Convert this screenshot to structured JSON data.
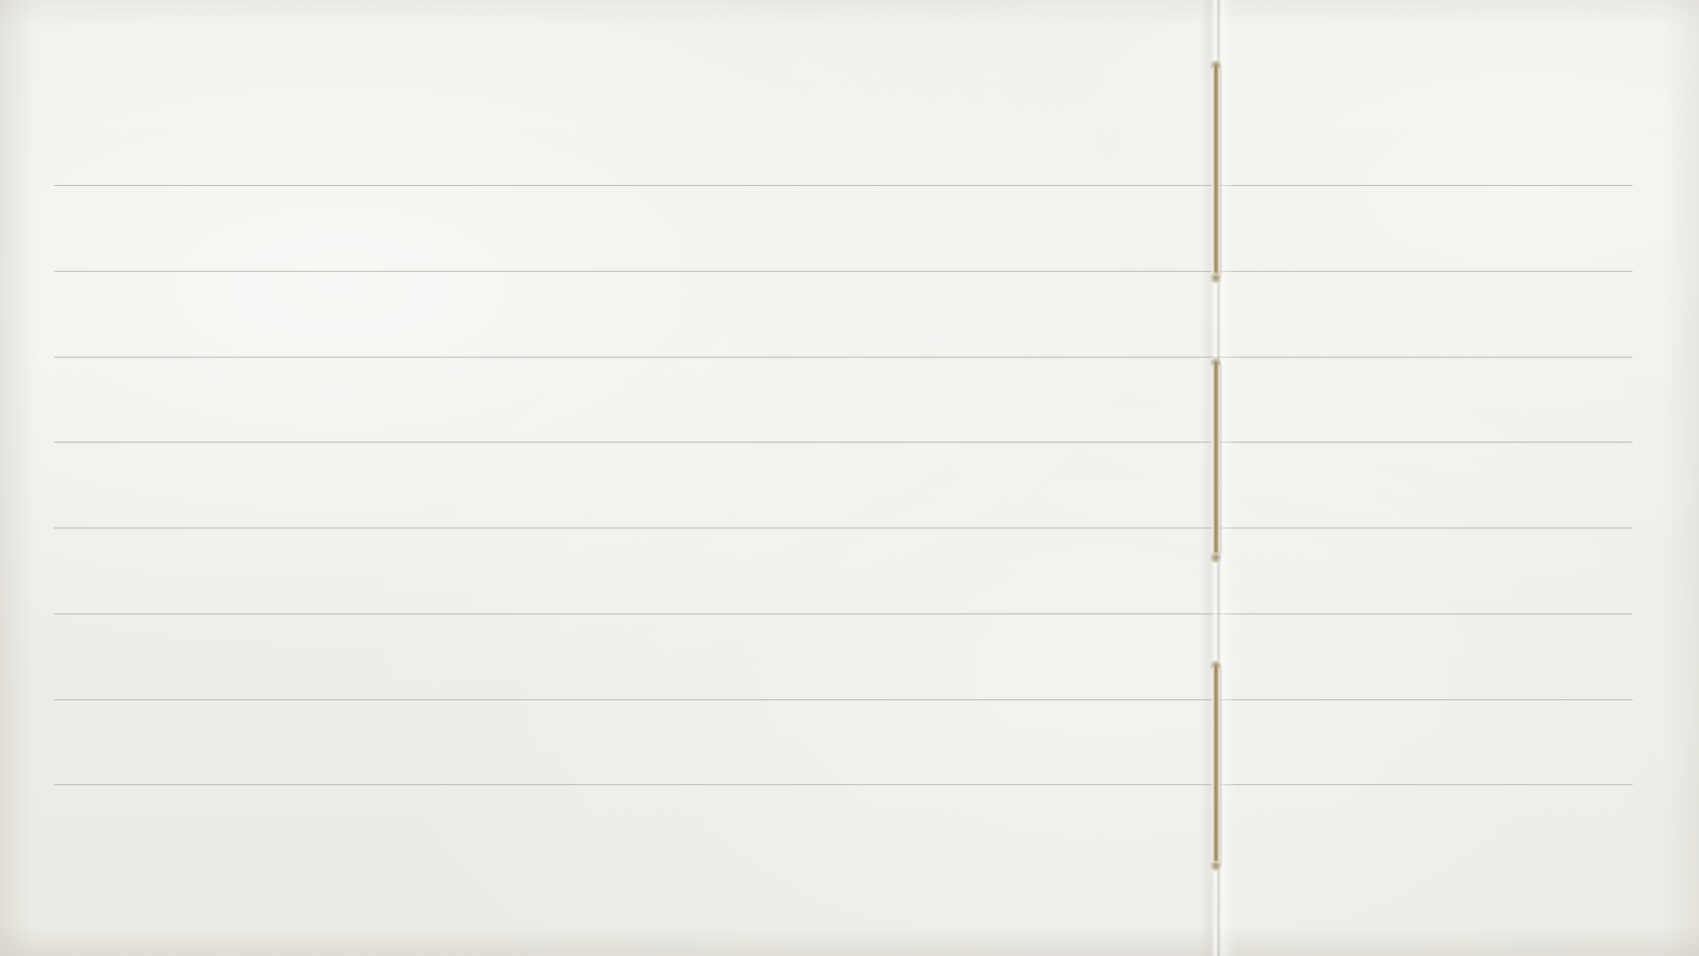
{
  "page": {
    "paper_color": "#eeede8",
    "line_color": "#b7b6b2",
    "thread_color": "#8d7b58",
    "ruled_line_count": 8,
    "stitch_count": 3
  }
}
